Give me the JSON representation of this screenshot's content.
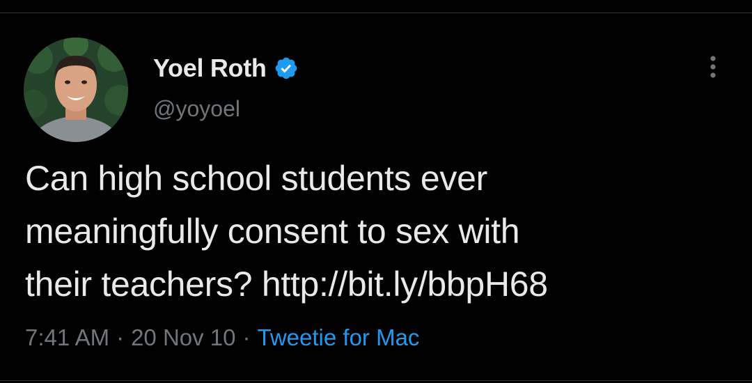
{
  "tweet": {
    "author": {
      "display_name": "Yoel Roth",
      "handle": "@yoyoel",
      "verified": true
    },
    "text_lines": [
      "Can high school students ever",
      "meaningfully consent to sex with",
      "their teachers? "
    ],
    "link": "http://bit.ly/bbpH68",
    "time": "7:41 AM",
    "separator": "·",
    "date": "20 Nov 10",
    "source": "Tweetie for Mac"
  },
  "icons": {
    "verified": "verified-badge-icon",
    "more": "more-options-icon"
  },
  "colors": {
    "background": "#000000",
    "primary_text": "#e7e9ea",
    "secondary_text": "#71767b",
    "accent": "#1d9bf0",
    "divider": "#2f3336"
  }
}
